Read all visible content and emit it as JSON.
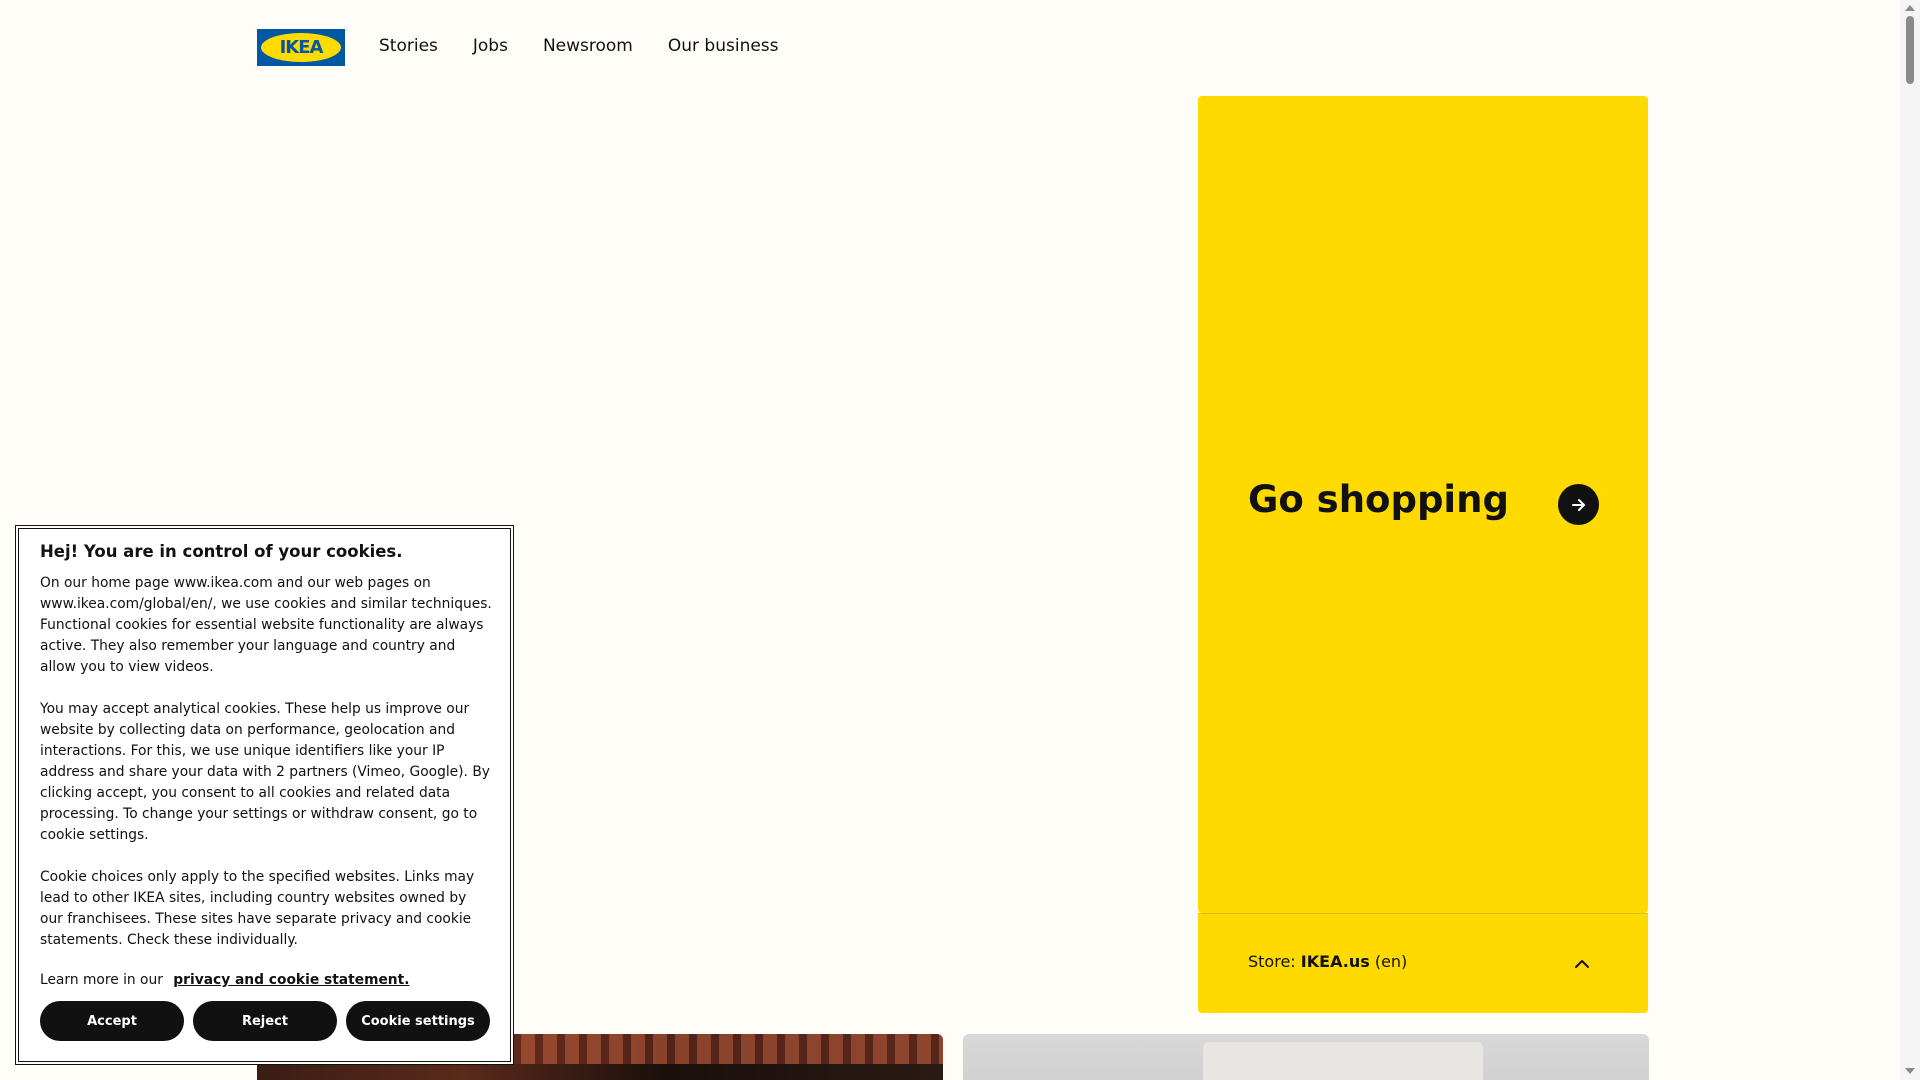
{
  "header": {
    "logo_text": "IKEA",
    "nav": [
      "Stories",
      "Jobs",
      "Newsroom",
      "Our business"
    ]
  },
  "shop_panel": {
    "title": "Go shopping",
    "arrow_icon": "arrow-right-icon",
    "store_label": "Store:",
    "store_name": "IKEA.us",
    "store_lang": "(en)",
    "chevron_icon": "chevron-up-icon",
    "background": "#ffda00"
  },
  "cookie": {
    "title": "Hej! You are in control of your cookies.",
    "paragraphs": [
      "On our home page www.ikea.com and our web pages on www.ikea.com/global/en/, we use cookies and similar techniques. Functional cookies for essential website functionality are always active. They also remember your language and country and allow you to view videos.",
      "You may accept analytical cookies. These help us improve our website by collecting data on performance, geolocation and interactions. For this, we use unique identifiers like your IP address and share your data with 2 partners (Vimeo, Google). By clicking accept, you consent to all cookies and related data processing. To change your settings or withdraw consent, go to cookie settings.",
      "Cookie choices only apply to the specified websites. Links may lead to other IKEA sites, including country websites owned by our franchisees. These sites have separate privacy and cookie statements. Check these individually."
    ],
    "learn_more": "Learn more in our",
    "privacy_link": "privacy and cookie statement.",
    "buttons": {
      "accept": "Accept",
      "reject": "Reject",
      "settings": "Cookie settings"
    }
  },
  "colors": {
    "brand_blue": "#0058a3",
    "brand_yellow": "#ffdb00"
  }
}
